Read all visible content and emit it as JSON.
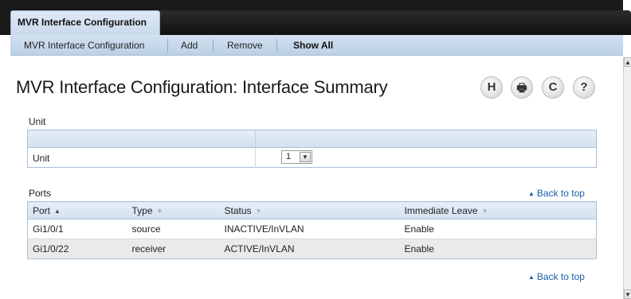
{
  "tabs": [
    {
      "label": "MVR Interface Configuration",
      "active": true
    }
  ],
  "subnav": {
    "items": [
      "MVR Interface Configuration",
      "Add",
      "Remove",
      "Show All"
    ],
    "active": "Show All"
  },
  "page": {
    "title": "MVR Interface Configuration: Interface Summary",
    "tools": [
      {
        "icon": "save-icon",
        "glyph": "H"
      },
      {
        "icon": "print-icon",
        "glyph": "🖶"
      },
      {
        "icon": "refresh-icon",
        "glyph": "C"
      },
      {
        "icon": "help-icon",
        "glyph": "?"
      }
    ]
  },
  "unit_section": {
    "title": "Unit",
    "row_label": "Unit",
    "selected": "1"
  },
  "ports_section": {
    "title": "Ports",
    "back_to_top": "Back to top",
    "columns": [
      "Port",
      "Type",
      "Status",
      "Immediate Leave"
    ],
    "sorted_column": "Port",
    "rows": [
      {
        "port": "Gi1/0/1",
        "type": "source",
        "status": "INACTIVE/InVLAN",
        "immediate_leave": "Enable"
      },
      {
        "port": "Gi1/0/22",
        "type": "receiver",
        "status": "ACTIVE/InVLAN",
        "immediate_leave": "Enable"
      }
    ]
  },
  "colors": {
    "tabbar": "#1a1a1a",
    "nav_bg": "#c9daec",
    "link": "#1a5fa8"
  }
}
